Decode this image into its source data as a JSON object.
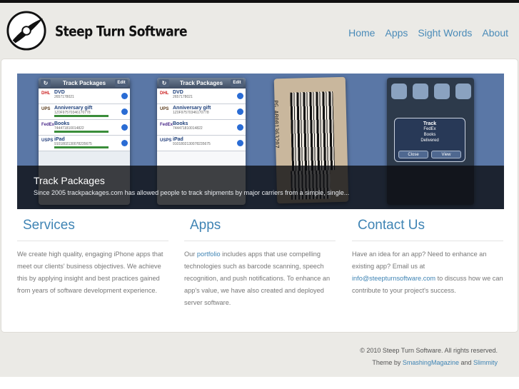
{
  "header": {
    "brand": "Steep Turn Software",
    "nav": [
      "Home",
      "Apps",
      "Sight Words",
      "About"
    ]
  },
  "slider": {
    "caption_title": "Track Packages",
    "caption_text": "Since 2005 trackpackages.com has allowed people to track shipments by major carriers from a simple, single...",
    "phone1": {
      "title": "Track Packages",
      "edit": "Edit",
      "rows": [
        {
          "carrier": "DHL",
          "name": "DVD",
          "number": "2657178021"
        },
        {
          "carrier": "UPS",
          "name": "Anniversary gift",
          "number": "1Z0F97570346170778"
        },
        {
          "carrier": "FedEx",
          "name": "Books",
          "number": "744471810014822"
        },
        {
          "carrier": "USPS",
          "name": "iPad",
          "number": "9101802130078235675"
        }
      ]
    },
    "phone2": {
      "title": "Track Packages",
      "edit": "Edit",
      "rows": [
        {
          "carrier": "DHL",
          "name": "DVD",
          "number": "2657178021"
        },
        {
          "carrier": "UPS",
          "name": "Anniversary gift",
          "number": "1Z0F97570346170778"
        },
        {
          "carrier": "FedEx",
          "name": "Books",
          "number": "744471810014822"
        },
        {
          "carrier": "USPS",
          "name": "iPad",
          "number": "9101802130078235675"
        }
      ]
    },
    "barcode_label": "PG AB001363207",
    "alert": {
      "title": "Track",
      "lines": [
        "FedEx",
        "Books",
        "Delivered"
      ],
      "close": "Close",
      "view": "View"
    }
  },
  "services": {
    "title": "Services",
    "text": "We create high quality, engaging iPhone apps that meet our clients' business objectives. We achieve this by applying insight and best practices gained from years of software development experience."
  },
  "apps": {
    "title": "Apps",
    "text_before": "Our ",
    "link": "portfolio",
    "text_after": " includes apps that use compelling technologies such as barcode scanning, speech recognition, and push notifications. To enhance an app's value, we have also created and deployed server software."
  },
  "contact": {
    "title": "Contact Us",
    "text_before": "Have an idea for an app? Need to enhance an existing app? Email us at ",
    "email": "info@steepturnsoftware.com",
    "text_after": " to discuss how we can contribute to your project's success."
  },
  "footer": {
    "copyright": "© 2010 Steep Turn Software. All rights reserved.",
    "theme_by": "Theme by ",
    "theme1": "SmashingMagazine",
    "and": " and ",
    "theme2": "Slimmity"
  },
  "colors": {
    "accent": "#3f84b4",
    "background": "#ebeae6",
    "slider_bg": "#5a77a6"
  }
}
